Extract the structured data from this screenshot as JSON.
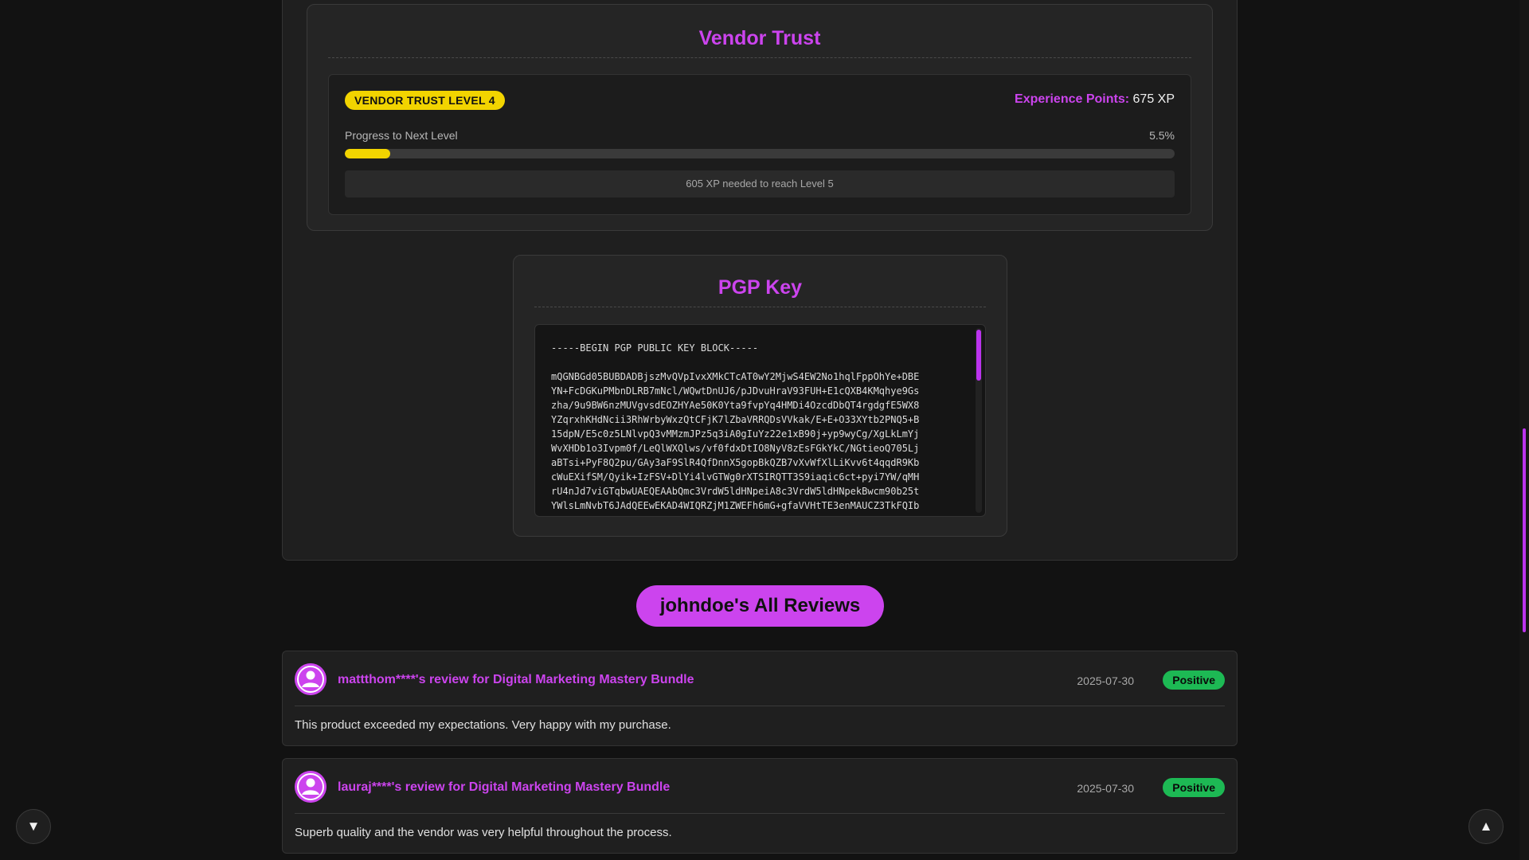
{
  "vendor_trust": {
    "title": "Vendor Trust",
    "level_badge": "VENDOR TRUST LEVEL 4",
    "xp_label": "Experience Points:",
    "xp_value": "675 XP",
    "progress_label": "Progress to Next Level",
    "progress_text": "5.5%",
    "progress_fraction": 0.055,
    "xp_needed": "605 XP needed to reach Level 5"
  },
  "pgp": {
    "title": "PGP Key",
    "key_text": "-----BEGIN PGP PUBLIC KEY BLOCK-----\n\nmQGNBGd05BUBDADBjszMvQVpIvxXMkCTcAT0wY2MjwS4EW2No1hqlFppOhYe+DBE\nYN+FcDGKuPMbnDLRB7mNcl/WQwtDnUJ6/pJDvuHraV93FUH+E1cQXB4KMqhye9Gs\nzha/9u9BW6nzMUVgvsdEOZHYAe50K0Yta9fvpYq4HMDi4OzcdDbQT4rgdgfE5WX8\nYZqrxhKHdNcii3RhWrbyWxzQtCFjK7lZbaVRRQDsVVkak/E+E+O33XYtb2PNQ5+B\n15dpN/E5c0z5LNlvpQ3vMMzmJPz5q3iA0gIuYz22e1xB90j+yp9wyCg/XgLkLmYj\nWvXHDb1o3Ivpm0f/LeQlWXQlws/vf0fdxDtIO8NyV8zEsFGkYkC/NGtieoQ705Lj\naBTsi+PyF8Q2pu/GAy3aF9SlR4QfDnnX5gopBkQZB7vXvWfXlLiKvv6t4qqdR9Kb\ncWuEXifSM/Qyik+IzFSV+DlYi4lvGTWg0rXTSIRQTT3S9iaqic6ct+pyi7YW/qMH\nrU4nJd7viGTqbwUAEQEAAbQmc3VrdW5ldHNpeiA8c3VrdW5ldHNpekBwcm90b25t\nYWlsLmNvbT6JAdQEEwEKAD4WIQRZjM1ZWEFh6mG+gfaVVHtTE3enMAUCZ3TkFQIb"
  },
  "all_reviews_button": "johndoe's All Reviews",
  "reviews": [
    {
      "title": "mattthom****'s review for Digital Marketing Mastery Bundle",
      "date": "2025-07-30",
      "sentiment": "Positive",
      "text": "This product exceeded my expectations. Very happy with my purchase."
    },
    {
      "title": "lauraj****'s review for Digital Marketing Mastery Bundle",
      "date": "2025-07-30",
      "sentiment": "Positive",
      "text": "Superb quality and the vendor was very helpful throughout the process."
    }
  ],
  "nav": {
    "scroll_down_glyph": "▼",
    "scroll_up_glyph": "▲"
  },
  "colors": {
    "accent": "#cc44ee",
    "level_badge": "#f2d400",
    "positive_badge": "#1db954",
    "background": "#121212"
  },
  "icons": [
    "user-avatar-icon",
    "chevron-down-icon",
    "chevron-up-icon"
  ]
}
